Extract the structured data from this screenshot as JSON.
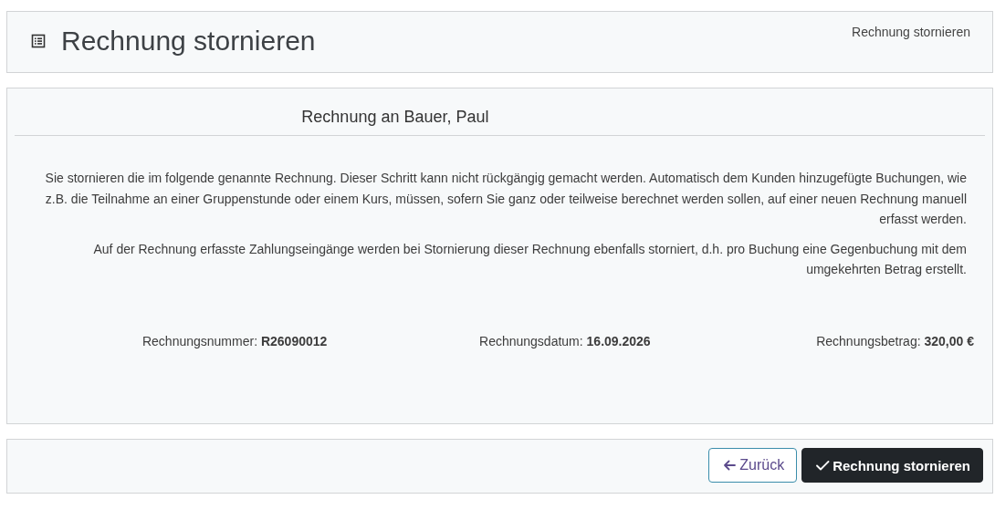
{
  "header": {
    "title": "Rechnung stornieren",
    "breadcrumb": "Rechnung stornieren"
  },
  "invoice": {
    "heading": "Rechnung an Bauer, Paul",
    "paragraphs": [
      "Sie stornieren die im folgende genannte Rechnung. Dieser Schritt kann nicht rückgängig gemacht werden. Automatisch dem Kunden hinzugefügte Buchungen, wie z.B. die Teilnahme an einer Gruppenstunde oder einem Kurs, müssen, sofern Sie ganz oder teilweise berechnet werden sollen, auf einer neuen Rechnung manuell erfasst werden.",
      "Auf der Rechnung erfasste Zahlungseingänge werden bei Stornierung dieser Rechnung ebenfalls storniert, d.h. pro Buchung eine Gegenbuchung mit dem umgekehrten Betrag erstellt."
    ],
    "details": [
      {
        "label": "Rechnungsnummer:",
        "value": "R26090012"
      },
      {
        "label": "Rechnungsdatum:",
        "value": "16.09.2026"
      },
      {
        "label": "Rechnungsbetrag:",
        "value": "320,00 €"
      }
    ]
  },
  "buttons": [
    {
      "kind": "back",
      "label": "Zurück"
    },
    {
      "kind": "confirm",
      "label": "Rechnung stornieren"
    }
  ]
}
